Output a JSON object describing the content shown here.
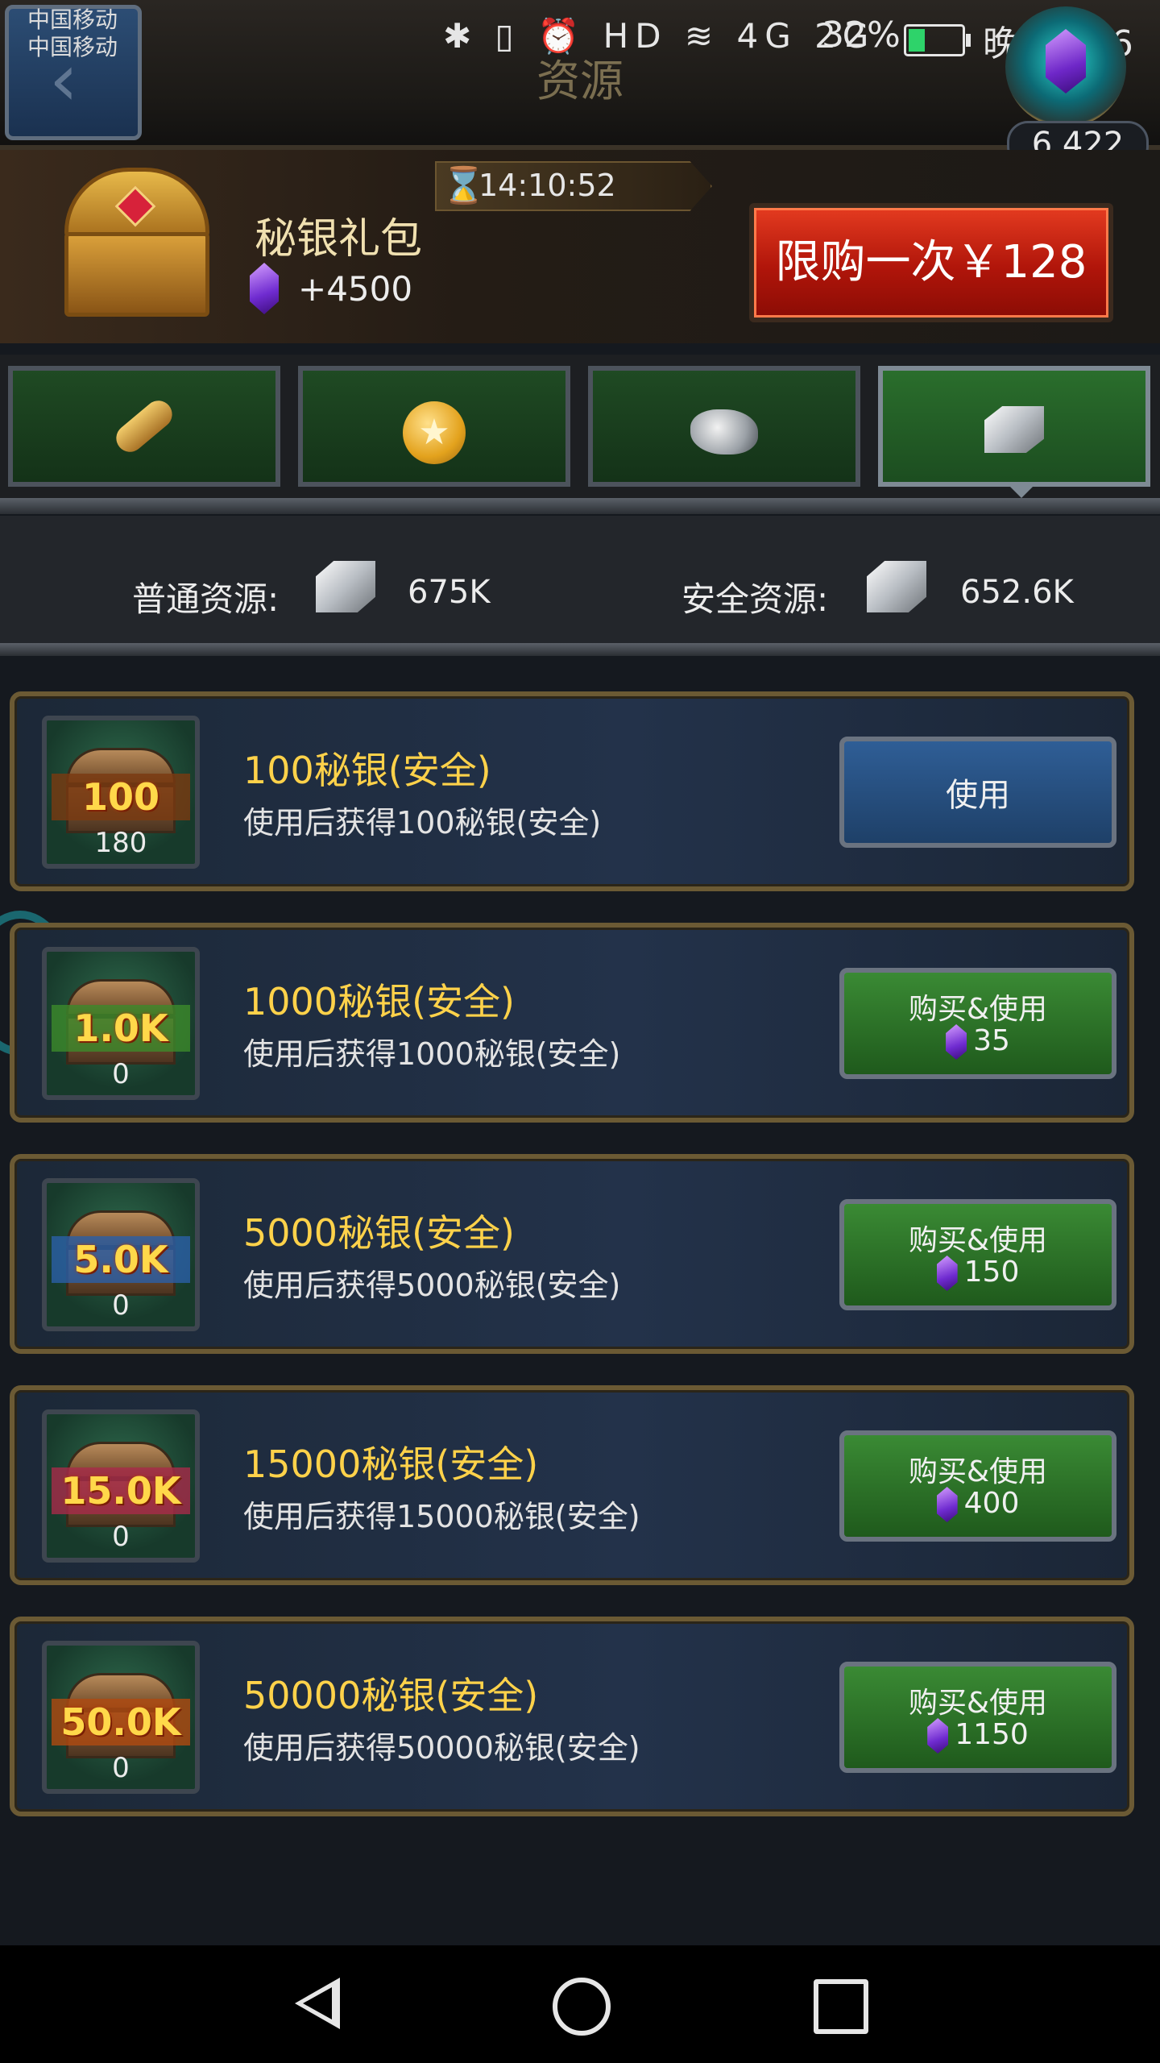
{
  "status_bar": {
    "carrier_1": "中国移动",
    "carrier_2": "中国移动",
    "icons": "✱ ▯ ⏰ HD ≋ 4G 2G",
    "battery_pct": "32%",
    "battery_level": 0.32,
    "time": "晚上9:46"
  },
  "header": {
    "title": "资源",
    "back_icon": "back-arrow-icon",
    "gem_balance": "6,422"
  },
  "offer": {
    "timer": "14:10:52",
    "name": "秘银礼包",
    "gem_amount": "+4500",
    "buy_label": "限购一次￥128"
  },
  "tabs": [
    {
      "icon": "wood-log-icon",
      "glyph": ""
    },
    {
      "icon": "gold-coin-icon",
      "glyph": "★"
    },
    {
      "icon": "iron-ore-icon",
      "glyph": ""
    },
    {
      "icon": "mithril-ingot-icon",
      "glyph": "",
      "active": true
    }
  ],
  "summary": {
    "normal_label": "普通资源:",
    "normal_value": "675K",
    "safe_label": "安全资源:",
    "safe_value": "652.6K"
  },
  "items": [
    {
      "badge": "100",
      "count": "180",
      "title": "100秘银(安全)",
      "desc": "使用后获得100秘银(安全)",
      "button": "使用",
      "type": "use",
      "price": ""
    },
    {
      "badge": "1.0K",
      "count": "0",
      "title": "1000秘银(安全)",
      "desc": "使用后获得1000秘银(安全)",
      "button": "购买&使用",
      "type": "buy",
      "price": "35"
    },
    {
      "badge": "5.0K",
      "count": "0",
      "title": "5000秘银(安全)",
      "desc": "使用后获得5000秘银(安全)",
      "button": "购买&使用",
      "type": "buy",
      "price": "150"
    },
    {
      "badge": "15.0K",
      "count": "0",
      "title": "15000秘银(安全)",
      "desc": "使用后获得15000秘银(安全)",
      "button": "购买&使用",
      "type": "buy",
      "price": "400"
    },
    {
      "badge": "50.0K",
      "count": "0",
      "title": "50000秘银(安全)",
      "desc": "使用后获得50000秘银(安全)",
      "button": "购买&使用",
      "type": "buy",
      "price": "1150"
    }
  ],
  "colors": {
    "title_gold": "#ffd24a",
    "buy_red": "#c41a0c",
    "buy_green": "#2f7a2a",
    "use_blue": "#2f5e96"
  }
}
